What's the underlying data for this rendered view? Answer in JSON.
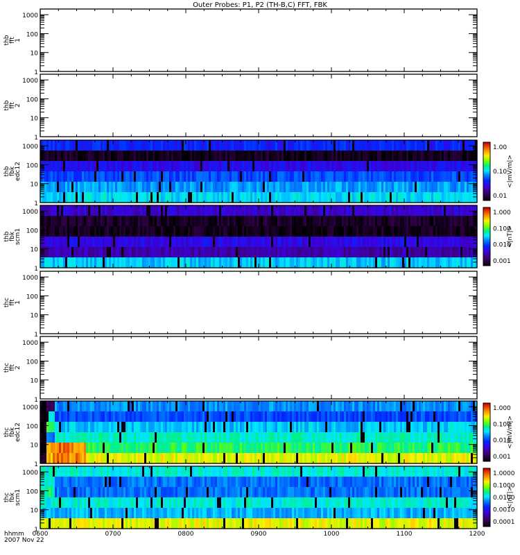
{
  "chart_data": {
    "type": "heatmap",
    "title": "Outer Probes: P1, P2 (TH-B,C) FFT, FBK",
    "x_ticks": [
      "0600",
      "0700",
      "0800",
      "0900",
      "1000",
      "1100",
      "1200"
    ],
    "x_label_line1": "hhmm",
    "x_label_line2": "2007 Nov 22",
    "xlim_hours": [
      6,
      12
    ],
    "ylim": [
      1,
      2000
    ],
    "y_ticks": [
      "1",
      "10",
      "100",
      "1000"
    ],
    "panels": [
      {
        "label": [
          "thb",
          "fft",
          "1"
        ],
        "empty": true
      },
      {
        "label": [
          "thb",
          "fft",
          "2"
        ],
        "empty": true
      },
      {
        "label": [
          "thb",
          "fbk",
          "edc12"
        ],
        "empty": false,
        "cbar_ticks": [
          "1.00",
          "0.10",
          "0.01"
        ],
        "cbar_label": "<|mV/m|>",
        "bands": [
          0.33,
          0.04,
          0.28,
          0.38,
          0.46,
          0.52
        ],
        "early": null
      },
      {
        "label": [
          "thb",
          "fbk",
          "scm1"
        ],
        "empty": false,
        "cbar_ticks": [
          "1.000",
          "0.100",
          "0.010",
          "0.001"
        ],
        "cbar_label": "<|nT|>",
        "bands": [
          0.24,
          0.05,
          0.04,
          0.27,
          0.2,
          0.5
        ],
        "early": null
      },
      {
        "label": [
          "thc",
          "fft",
          "1"
        ],
        "empty": true
      },
      {
        "label": [
          "thc",
          "fft",
          "2"
        ],
        "empty": true
      },
      {
        "label": [
          "thc",
          "fbk",
          "edc12"
        ],
        "empty": false,
        "cbar_ticks": [
          "1.000",
          "0.100",
          "0.010",
          "0.001"
        ],
        "cbar_label": "<|mV/m|>",
        "bands": [
          0.45,
          0.38,
          0.5,
          0.56,
          0.62,
          0.76
        ],
        "early": [
          0.12,
          0.55,
          0.62,
          0.4,
          0.2,
          0.55
        ]
      },
      {
        "label": [
          "thc",
          "fbk",
          "scm1"
        ],
        "empty": false,
        "cbar_ticks": [
          "1.0000",
          "0.1000",
          "0.0100",
          "0.0010",
          "0.0001"
        ],
        "cbar_label": "<|nT|>",
        "bands": [
          0.55,
          0.42,
          0.42,
          0.55,
          0.48,
          0.76
        ],
        "early": [
          0.55,
          0.55,
          0.6,
          0.55,
          0.5,
          0.76
        ]
      }
    ]
  }
}
